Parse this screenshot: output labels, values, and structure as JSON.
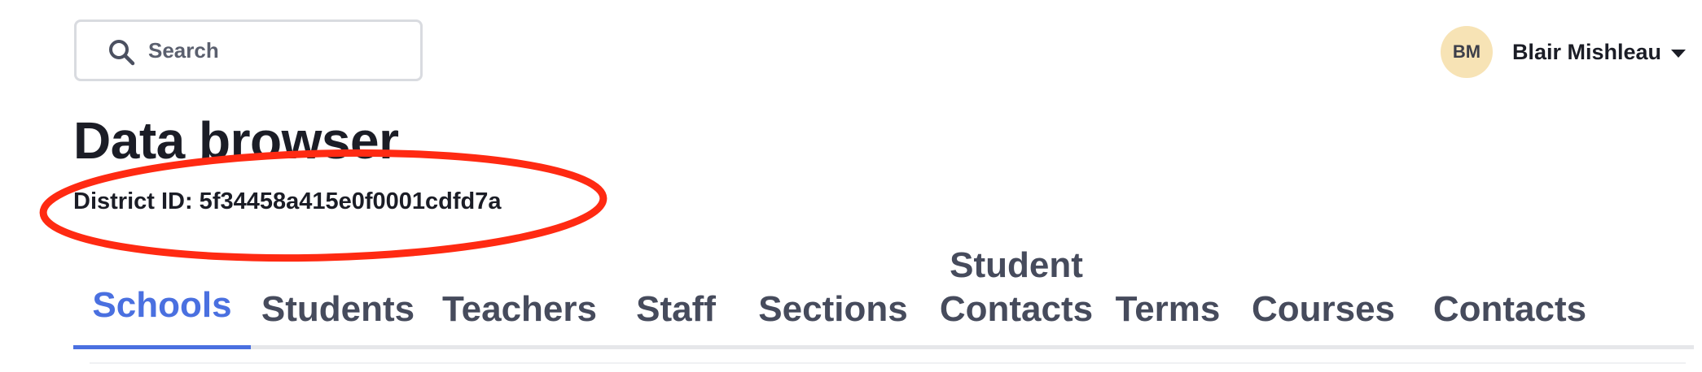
{
  "search": {
    "placeholder": "Search"
  },
  "user": {
    "initials": "BM",
    "name": "Blair Mishleau",
    "avatar_color": "#f7e3b5"
  },
  "page": {
    "title": "Data browser",
    "district_id": "District ID: 5f34458a415e0f0001cdfd7a"
  },
  "annotation": {
    "color": "#ff2a12"
  },
  "tabs": [
    {
      "label": "Schools",
      "active": true
    },
    {
      "label": "Students",
      "active": false
    },
    {
      "label": "Teachers",
      "active": false
    },
    {
      "label": "Staff",
      "active": false
    },
    {
      "label": "Sections",
      "active": false
    },
    {
      "label": "Student Contacts",
      "active": false
    },
    {
      "label": "Terms",
      "active": false
    },
    {
      "label": "Courses",
      "active": false
    },
    {
      "label": "Contacts",
      "active": false
    }
  ],
  "colors": {
    "accent": "#4a70e0",
    "tab_text": "#464b5c"
  }
}
